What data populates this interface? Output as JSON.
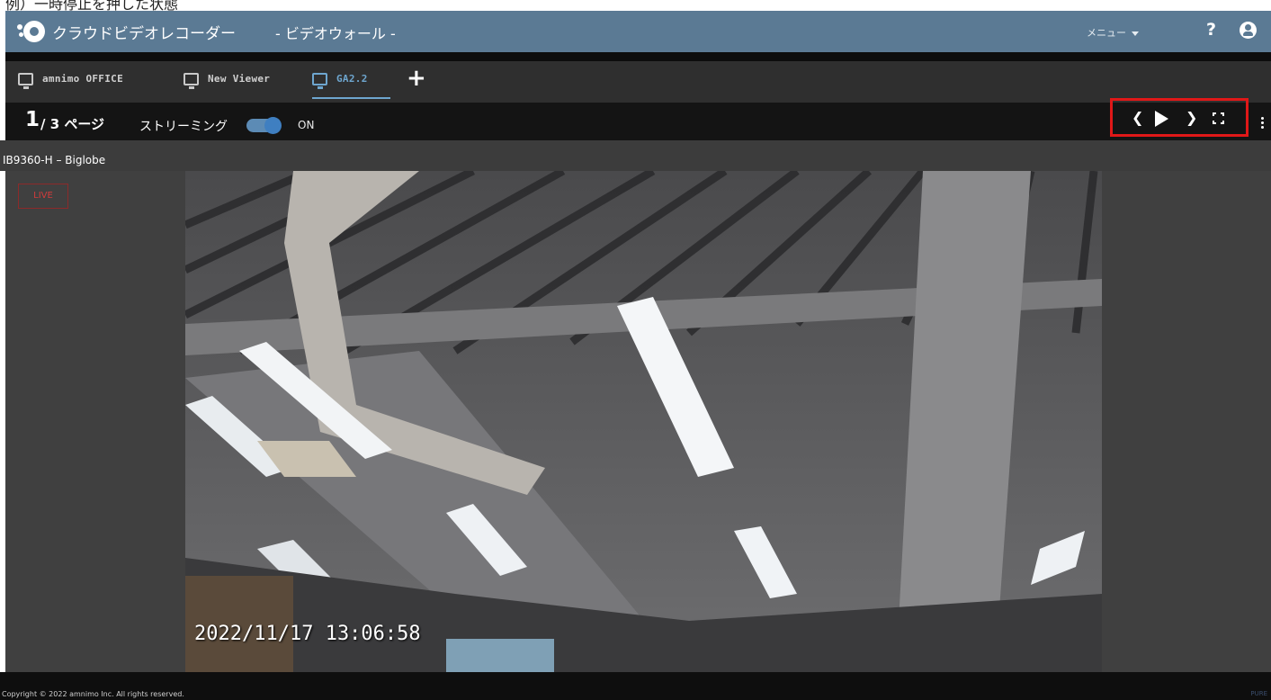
{
  "caption": "例）一時停止を押した状態",
  "app": {
    "title": "クラウドビデオレコーダー",
    "subtitle": "- ビデオウォール -",
    "menu_label": "メニュー",
    "help_label": "?"
  },
  "tabs": [
    {
      "label": "amnimo OFFICE",
      "active": false
    },
    {
      "label": "New Viewer",
      "active": false
    },
    {
      "label": "GA2.2",
      "active": true
    }
  ],
  "add_tab_label": "+",
  "controls": {
    "current_page": "1",
    "page_total": "/ 3 ページ",
    "streaming_label": "ストリーミング",
    "streaming_on": true,
    "streaming_state": "ON"
  },
  "camera": {
    "name": "IB9360-H – Biglobe",
    "status_badge": "LIVE",
    "timestamp": "2022/11/17 13:06:58"
  },
  "footer": {
    "copyright": "Copyright © 2022 amnimo Inc. All rights reserved.",
    "brand": "PURE"
  },
  "colors": {
    "titlebar": "#5b7a94",
    "accent_tab": "#6ea6cf",
    "highlight_box": "#e01818",
    "live": "#d23b3b"
  },
  "icons": [
    "logo-icon",
    "monitor-icon",
    "add-icon",
    "help-icon",
    "user-icon",
    "prev-icon",
    "play-icon",
    "next-icon",
    "fullscreen-icon",
    "more-vertical-icon"
  ]
}
